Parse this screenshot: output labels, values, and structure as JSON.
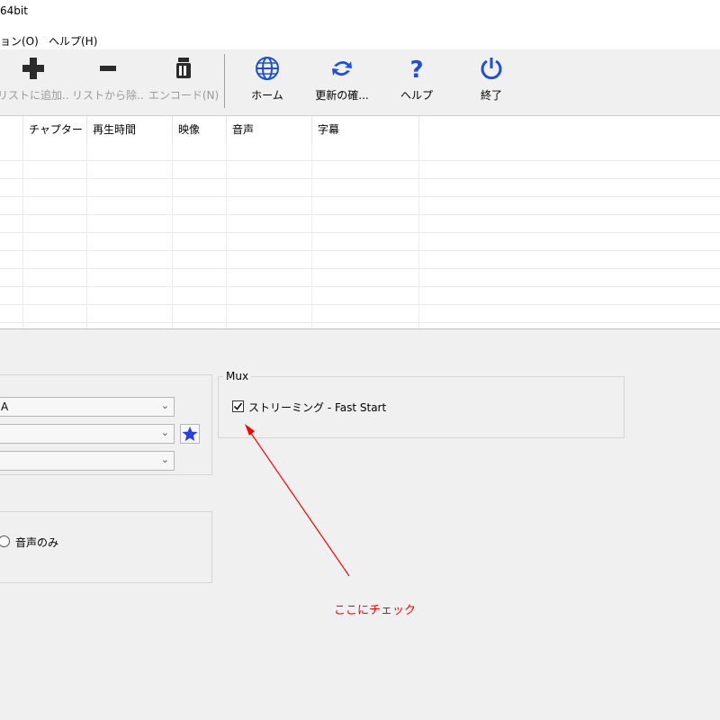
{
  "window": {
    "title": "64bit"
  },
  "menu": {
    "items": [
      "ョン(O)",
      "ヘルプ(H)"
    ]
  },
  "toolbar": {
    "buttons": [
      {
        "label": "リストに追加...",
        "icon": "plus-icon",
        "enabled": false
      },
      {
        "label": "リストから除...",
        "icon": "minus-icon",
        "enabled": false
      },
      {
        "label": "エンコード(N)",
        "icon": "encode-icon",
        "enabled": false
      },
      {
        "label": "ホーム",
        "icon": "globe-icon",
        "enabled": true
      },
      {
        "label": "更新の確...",
        "icon": "refresh-icon",
        "enabled": true
      },
      {
        "label": "ヘルプ",
        "icon": "question-icon",
        "enabled": true
      },
      {
        "label": "終了",
        "icon": "power-icon",
        "enabled": true
      }
    ]
  },
  "list": {
    "columns": [
      "チャプター",
      "再生時間",
      "映像",
      "音声",
      "字幕"
    ]
  },
  "settings": {
    "combo1_value": "A",
    "mux": {
      "title": "Mux",
      "streaming_label": "ストリーミング - Fast Start",
      "streaming_checked": true
    },
    "audio_only_label": "音声のみ"
  },
  "annotation": {
    "text": "ここにチェック",
    "color": "#ff0000"
  },
  "colors": {
    "icon_blue": "#1e4fd8",
    "star_blue": "#2a3fe0"
  }
}
